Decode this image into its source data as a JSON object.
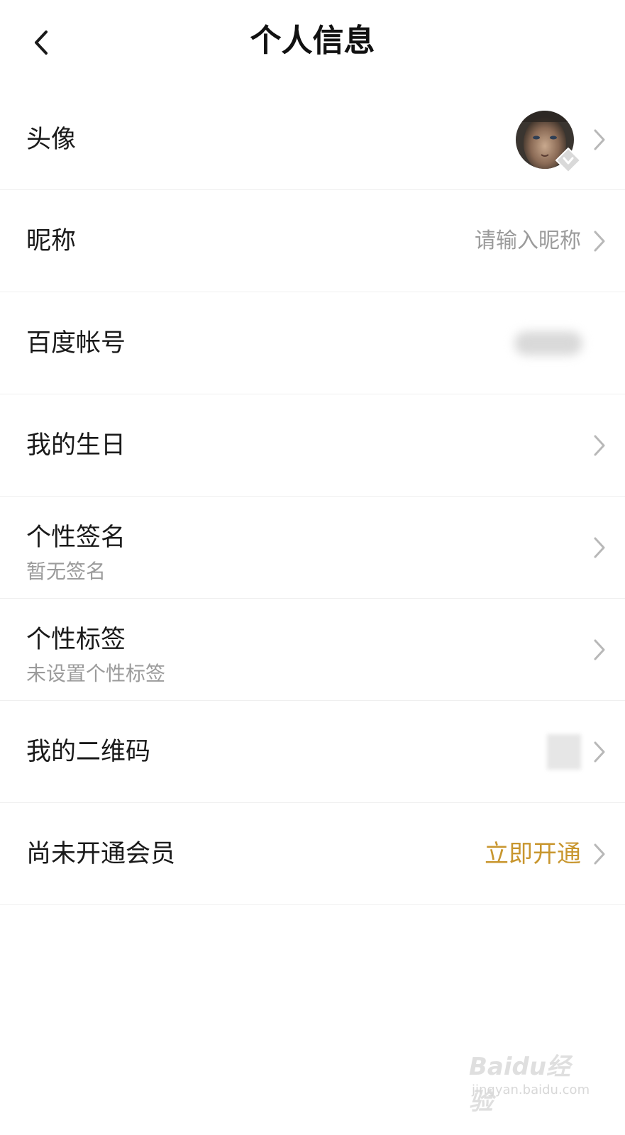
{
  "header": {
    "title": "个人信息",
    "back_icon": "chevron-left-icon"
  },
  "rows": [
    {
      "label": "头像",
      "value": "",
      "type": "avatar"
    },
    {
      "label": "昵称",
      "value": "请输入昵称"
    },
    {
      "label": "百度帐号",
      "value": ""
    },
    {
      "label": "我的生日",
      "value": ""
    },
    {
      "label": "个性签名",
      "sub": "暂无签名"
    },
    {
      "label": "个性标签",
      "sub": "未设置个性标签"
    },
    {
      "label": "我的二维码",
      "value": ""
    },
    {
      "label": "尚未开通会员",
      "value": "立即开通"
    }
  ],
  "colors": {
    "accent_gold": "#c8962e",
    "secondary_text": "#9b9b9b",
    "divider": "#efefef"
  },
  "watermark": {
    "brand": "Baidu经验",
    "site": "jingyan.baidu.com"
  }
}
